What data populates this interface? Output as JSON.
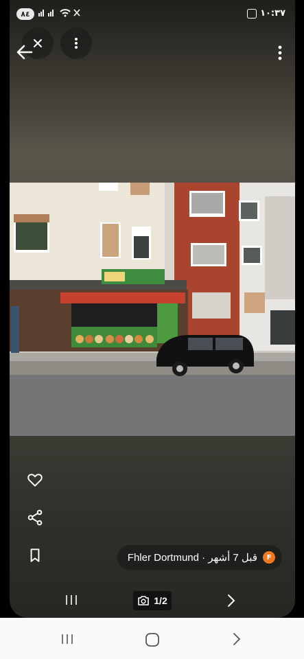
{
  "status_bar": {
    "battery_badge": "٨٤",
    "time": "١٠:٣٧"
  },
  "icons": {
    "close": "close-icon",
    "more_top": "more-vert-icon",
    "back": "arrow-left-icon",
    "more_right": "more-vert-icon",
    "like": "heart-outline-icon",
    "share": "share-icon",
    "bookmark": "bookmark-outline-icon",
    "camera": "camera-icon"
  },
  "photo": {
    "alt": "Storefront photo of a burger shop"
  },
  "info": {
    "place": "Fhler Dortmund",
    "time_ago": "قبل 7 أشهر",
    "avatar_letter": "F"
  },
  "photo_nav": {
    "counter": "1/2"
  },
  "colors": {
    "avatar": "#f07a22",
    "pill_bg": "#1f1f1d"
  }
}
